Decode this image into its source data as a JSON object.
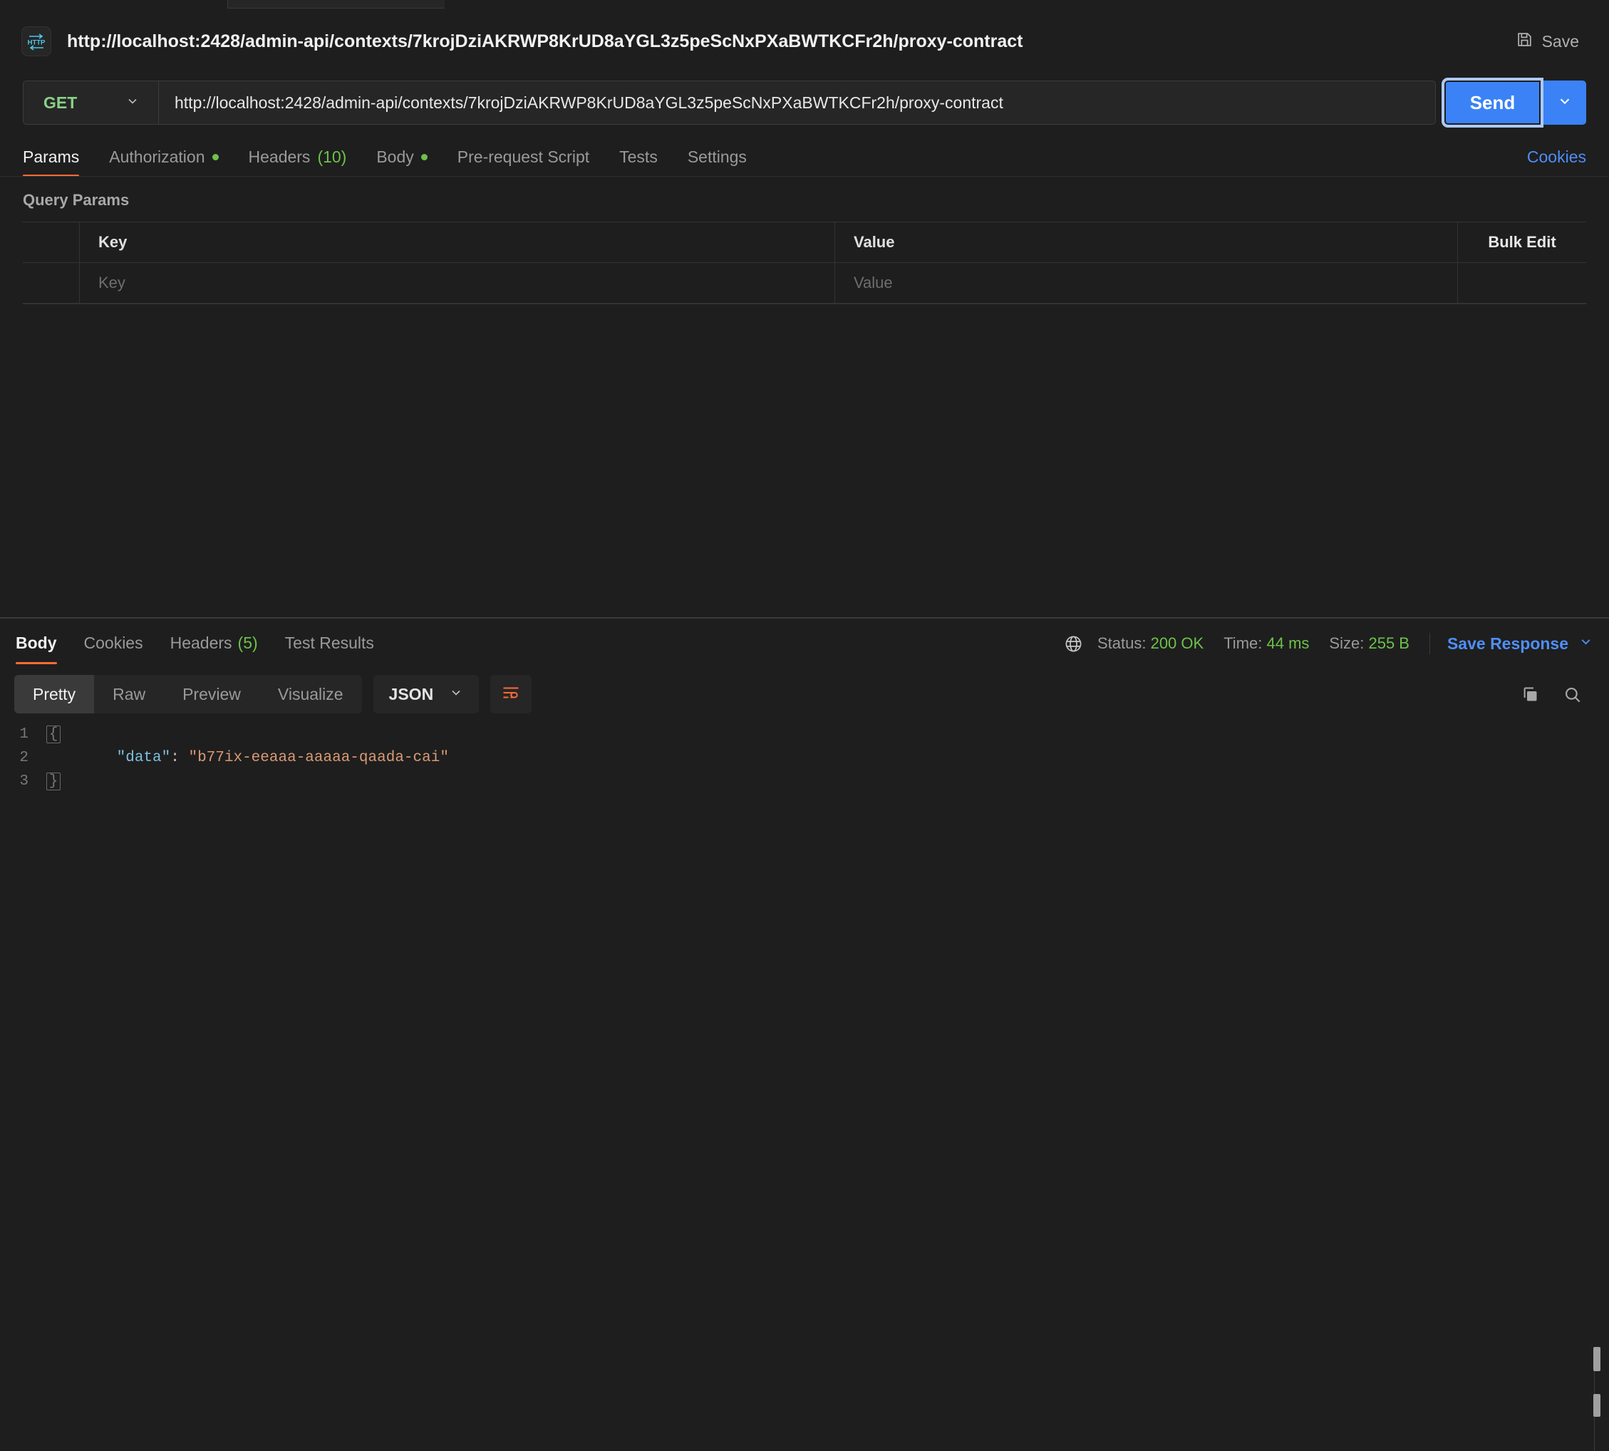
{
  "request": {
    "protocol_icon": "http-icon",
    "title": "http://localhost:2428/admin-api/contexts/7krojDziAKRWP8KrUD8aYGL3z5peScNxPXaBWTKCFr2h/proxy-contract",
    "save_label": "Save",
    "method": "GET",
    "url": "http://localhost:2428/admin-api/contexts/7krojDziAKRWP8KrUD8aYGL3z5peScNxPXaBWTKCFr2h/proxy-contract",
    "send_label": "Send",
    "tabs": [
      {
        "label": "Params",
        "active": true,
        "dot": false,
        "count": ""
      },
      {
        "label": "Authorization",
        "active": false,
        "dot": true,
        "count": ""
      },
      {
        "label": "Headers",
        "active": false,
        "dot": false,
        "count": "(10)"
      },
      {
        "label": "Body",
        "active": false,
        "dot": true,
        "count": ""
      },
      {
        "label": "Pre-request Script",
        "active": false,
        "dot": false,
        "count": ""
      },
      {
        "label": "Tests",
        "active": false,
        "dot": false,
        "count": ""
      },
      {
        "label": "Settings",
        "active": false,
        "dot": false,
        "count": ""
      }
    ],
    "cookies_link": "Cookies"
  },
  "query_params": {
    "section_title": "Query Params",
    "columns": {
      "key": "Key",
      "value": "Value",
      "bulk_edit": "Bulk Edit"
    },
    "rows": [
      {
        "key_placeholder": "Key",
        "value_placeholder": "Value"
      }
    ]
  },
  "response": {
    "tabs": [
      {
        "label": "Body",
        "active": true,
        "count": ""
      },
      {
        "label": "Cookies",
        "active": false,
        "count": ""
      },
      {
        "label": "Headers",
        "active": false,
        "count": "(5)"
      },
      {
        "label": "Test Results",
        "active": false,
        "count": ""
      }
    ],
    "status": {
      "label": "Status:",
      "value": "200 OK"
    },
    "time": {
      "label": "Time:",
      "value": "44 ms"
    },
    "size": {
      "label": "Size:",
      "value": "255 B"
    },
    "save_response_label": "Save Response",
    "format_tabs": [
      {
        "label": "Pretty",
        "active": true
      },
      {
        "label": "Raw",
        "active": false
      },
      {
        "label": "Preview",
        "active": false
      },
      {
        "label": "Visualize",
        "active": false
      }
    ],
    "content_type": "JSON",
    "body_lines": [
      {
        "num": "1",
        "fold": "{",
        "indent": 0,
        "segments": []
      },
      {
        "num": "2",
        "fold": "",
        "indent": 1,
        "segments": [
          {
            "text": "\"data\"",
            "type": "key"
          },
          {
            "text": ": ",
            "type": "punc"
          },
          {
            "text": "\"b77ix-eeaaa-aaaaa-qaada-cai\"",
            "type": "str"
          }
        ]
      },
      {
        "num": "3",
        "fold": "}",
        "indent": 0,
        "segments": []
      }
    ]
  },
  "colors": {
    "accent_orange": "#ff6c37",
    "accent_blue": "#3b82f6",
    "link_blue": "#4f8ef7",
    "success_green": "#6cc24a",
    "method_green": "#89d185",
    "bg": "#1e1e1e",
    "panel": "#262626",
    "json_key": "#7fbfe0",
    "json_string": "#d99a76"
  }
}
